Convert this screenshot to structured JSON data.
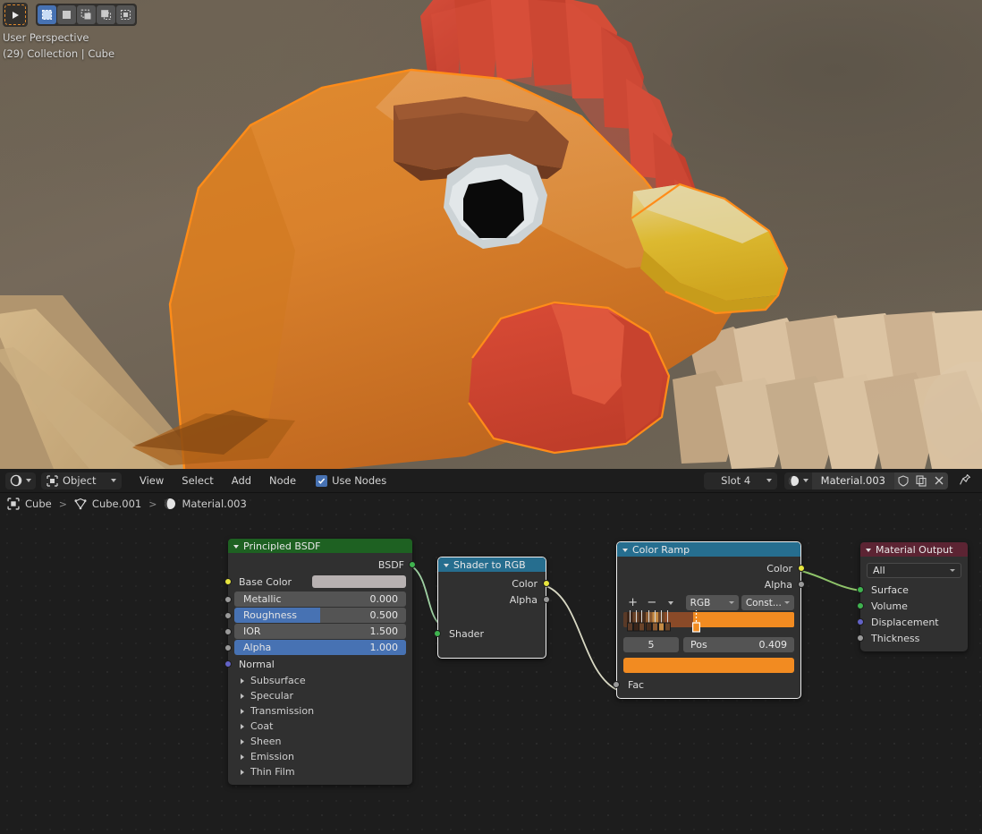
{
  "viewport": {
    "tools": [
      {
        "name": "playhead-gizmo-icon",
        "active": false
      },
      {
        "name": "select-box-icon",
        "active": true
      },
      {
        "name": "select-new-icon",
        "active": false
      },
      {
        "name": "select-extend-icon",
        "active": false
      },
      {
        "name": "select-subtract-icon",
        "active": false
      },
      {
        "name": "select-intersect-icon",
        "active": false
      }
    ],
    "perspective_label": "User Perspective",
    "scene_label": "(29) Collection | Cube"
  },
  "node_editor": {
    "header": {
      "editor_type_icon": "shader-editor-icon",
      "shader_type": "Object",
      "shader_type_icon": "object-icon",
      "menus": [
        "View",
        "Select",
        "Add",
        "Node"
      ],
      "use_nodes_label": "Use Nodes",
      "use_nodes_checked": true,
      "slot_label": "Slot 4",
      "material_icon": "material-sphere-icon",
      "material_name": "Material.003",
      "fake_user_icon": "shield-icon",
      "new_material_icon": "copy-icon",
      "unlink_icon": "close-x-icon",
      "pin_icon": "pin-icon"
    },
    "breadcrumb": [
      {
        "icon": "object-icon",
        "label": "Cube"
      },
      {
        "icon": "mesh-data-icon",
        "label": "Cube.001"
      },
      {
        "icon": "material-sphere-icon",
        "label": "Material.003"
      }
    ],
    "nodes": {
      "principled_bsdf": {
        "title": "Principled BSDF",
        "header_color": "#1e6122",
        "outputs": [
          {
            "label": "BSDF",
            "socket": "green"
          }
        ],
        "base_color": {
          "label": "Base Color",
          "socket": "yellow",
          "swatch": "#b7b1b1"
        },
        "sliders": [
          {
            "label": "Metallic",
            "value": "0.000",
            "fill_pct": 0,
            "socket": "gray"
          },
          {
            "label": "Roughness",
            "value": "0.500",
            "fill_pct": 50,
            "socket": "gray"
          },
          {
            "label": "IOR",
            "value": "1.500",
            "fill_pct": 0,
            "socket": "gray"
          },
          {
            "label": "Alpha",
            "value": "1.000",
            "fill_pct": 100,
            "socket": "gray"
          }
        ],
        "normal": {
          "label": "Normal",
          "socket": "purple"
        },
        "panels": [
          "Subsurface",
          "Specular",
          "Transmission",
          "Coat",
          "Sheen",
          "Emission",
          "Thin Film"
        ]
      },
      "shader_to_rgb": {
        "title": "Shader to RGB",
        "header_color": "#266e8f",
        "outputs": [
          {
            "label": "Color",
            "socket": "yellow"
          },
          {
            "label": "Alpha",
            "socket": "gray"
          }
        ],
        "inputs": [
          {
            "label": "Shader",
            "socket": "green"
          }
        ],
        "selected": true
      },
      "color_ramp": {
        "title": "Color Ramp",
        "header_color": "#266e8f",
        "outputs": [
          {
            "label": "Color",
            "socket": "yellow"
          },
          {
            "label": "Alpha",
            "socket": "gray"
          }
        ],
        "inputs": [
          {
            "label": "Fac",
            "socket": "gray"
          }
        ],
        "add_label": "+",
        "remove_label": "−",
        "menu_icon": "chevron-down-icon",
        "color_mode": "RGB",
        "interpolation": "Const...",
        "index_value": "5",
        "pos_label": "Pos",
        "pos_value": "0.409",
        "active_color": "#f28b21",
        "stops": [
          {
            "pos": 0.02,
            "color": "#5a3a27"
          },
          {
            "pos": 0.055,
            "color": "#3b2519"
          },
          {
            "pos": 0.09,
            "color": "#6b4429"
          },
          {
            "pos": 0.13,
            "color": "#472d1d"
          },
          {
            "pos": 0.17,
            "color": "#8a5a31"
          },
          {
            "pos": 0.205,
            "color": "#c58b44"
          },
          {
            "pos": 0.24,
            "color": "#6b4428"
          },
          {
            "pos": 0.409,
            "color": "#f28b21"
          }
        ],
        "ramp_base": "#8a4a28",
        "selected": true
      },
      "material_output": {
        "title": "Material Output",
        "header_color": "#5c2433",
        "target": "All",
        "inputs": [
          {
            "label": "Surface",
            "socket": "green"
          },
          {
            "label": "Volume",
            "socket": "green"
          },
          {
            "label": "Displacement",
            "socket": "purple"
          },
          {
            "label": "Thickness",
            "socket": "gray"
          }
        ]
      }
    }
  },
  "colors": {
    "accent_blue": "#4772b3",
    "node_bg": "#303030",
    "canvas_bg": "#1d1d1d",
    "header_bg": "#1d1d1d"
  }
}
